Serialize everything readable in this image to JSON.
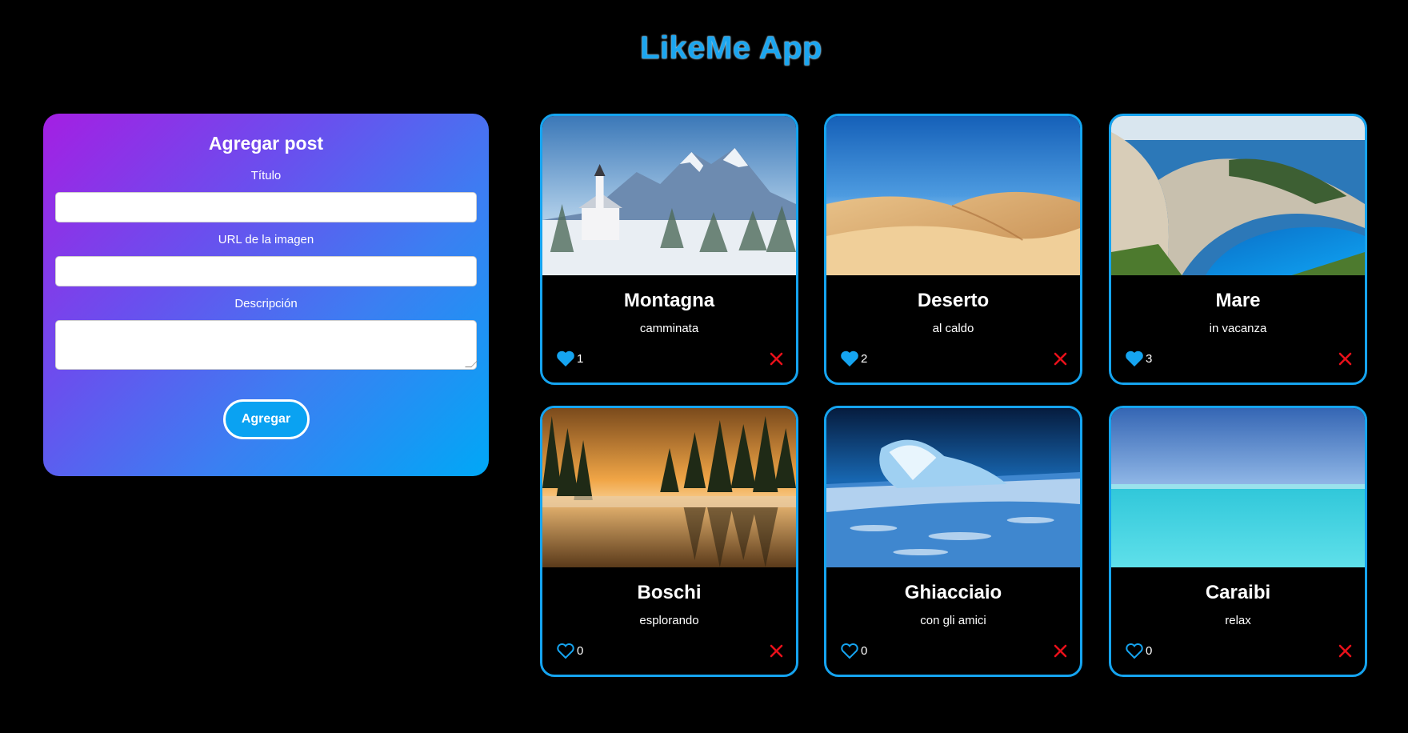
{
  "app": {
    "title": "LikeMe App"
  },
  "form": {
    "heading": "Agregar post",
    "title_label": "Título",
    "url_label": "URL de la imagen",
    "description_label": "Descripción",
    "title_value": "",
    "url_value": "",
    "description_value": "",
    "submit_label": "Agregar"
  },
  "colors": {
    "accent": "#15a4f0",
    "like_active": "#15a4f0",
    "delete": "#e8101a",
    "gradient_start": "#a41fe3",
    "gradient_end": "#00a8f6"
  },
  "posts": [
    {
      "title": "Montagna",
      "description": "camminata",
      "likes": "1",
      "liked": true,
      "image": "snowy-mountain-village"
    },
    {
      "title": "Deserto",
      "description": "al caldo",
      "likes": "2",
      "liked": true,
      "image": "sand-dunes"
    },
    {
      "title": "Mare",
      "description": "in vacanza",
      "likes": "3",
      "liked": true,
      "image": "beach-cove-cliffs"
    },
    {
      "title": "Boschi",
      "description": "esplorando",
      "likes": "0",
      "liked": false,
      "image": "forest-lake-sunrise"
    },
    {
      "title": "Ghiacciaio",
      "description": "con gli amici",
      "likes": "0",
      "liked": false,
      "image": "iceberg-in-sea"
    },
    {
      "title": "Caraibi",
      "description": "relax",
      "likes": "0",
      "liked": false,
      "image": "turquoise-sea"
    }
  ]
}
